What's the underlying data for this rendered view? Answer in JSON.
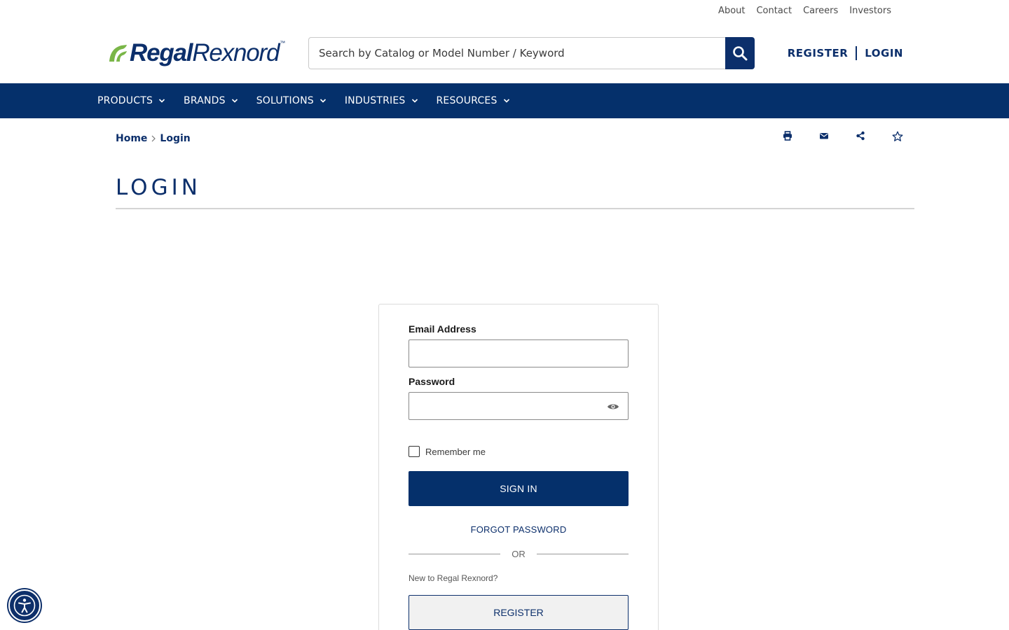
{
  "utility_links": [
    "About",
    "Contact",
    "Careers",
    "Investors"
  ],
  "brand": {
    "part1": "Regal",
    "part2": "Rexnord",
    "tm": "™"
  },
  "search": {
    "placeholder": "Search by Catalog or Model Number / Keyword",
    "icon": "search-icon"
  },
  "account": {
    "register": "REGISTER",
    "login": "LOGIN"
  },
  "nav": [
    "PRODUCTS",
    "BRANDS",
    "SOLUTIONS",
    "INDUSTRIES",
    "RESOURCES"
  ],
  "breadcrumb": {
    "home": "Home",
    "current": "Login"
  },
  "page_tools": [
    "print-icon",
    "email-icon",
    "share-icon",
    "favorite-star-icon"
  ],
  "page_title": "LOGIN",
  "form": {
    "email_label": "Email Address",
    "email_value": "",
    "password_label": "Password",
    "password_value": "",
    "remember_label": "Remember me",
    "remember_checked": false,
    "signin_label": "SIGN IN",
    "forgot_label": "FORGOT PASSWORD",
    "or_label": "OR",
    "new_to_label": "New to Regal Rexnord?",
    "register_label": "REGISTER"
  },
  "colors": {
    "primary": "#05306b",
    "brand_green": "#7ab648"
  },
  "accessibility_icon": "accessibility-icon"
}
